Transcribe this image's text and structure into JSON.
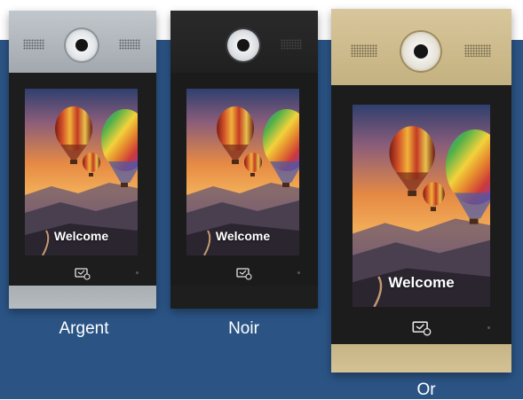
{
  "variants": [
    {
      "label": "Argent",
      "screen_text": "Welcome",
      "finish": "silver",
      "color": "#aeb3b8"
    },
    {
      "label": "Noir",
      "screen_text": "Welcome",
      "finish": "black",
      "color": "#2a2a2a"
    },
    {
      "label": "Or",
      "screen_text": "Welcome",
      "finish": "gold",
      "color": "#cdbb8f"
    }
  ],
  "icons": [
    "camera-icon",
    "speaker-grille-icon",
    "card-reader-icon"
  ],
  "colors": {
    "background": "#2b5485",
    "label": "#ffffff"
  }
}
